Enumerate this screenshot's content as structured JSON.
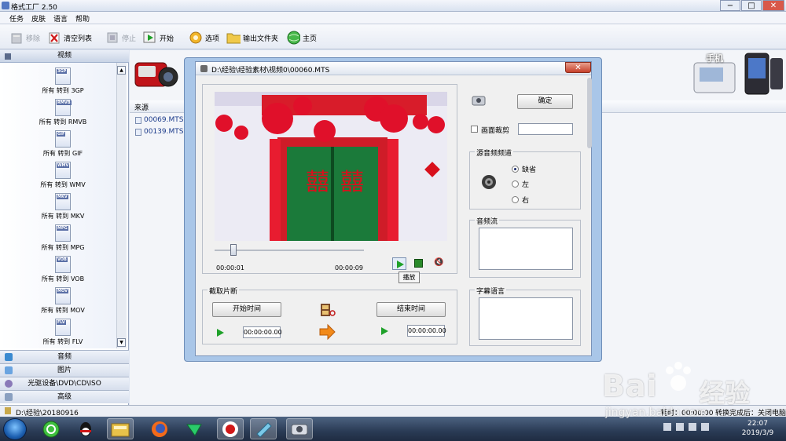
{
  "window": {
    "title": "格式工厂 2.50"
  },
  "menu": [
    "任务",
    "皮肤",
    "语言",
    "帮助"
  ],
  "toolbar": {
    "remove": "移除",
    "clear": "清空列表",
    "stop": "停止",
    "start": "开始",
    "options": "选项",
    "output": "输出文件夹",
    "home": "主页"
  },
  "left": {
    "video_header": "视频",
    "formats": [
      {
        "badge": "3GP",
        "label": "所有 转到 3GP"
      },
      {
        "badge": "RMVB",
        "label": "所有 转到 RMVB"
      },
      {
        "badge": "GIF",
        "label": "所有 转到 GIF"
      },
      {
        "badge": "WMV",
        "label": "所有 转到 WMV"
      },
      {
        "badge": "MKV",
        "label": "所有 转到 MKV"
      },
      {
        "badge": "MPG",
        "label": "所有 转到 MPG"
      },
      {
        "badge": "VOB",
        "label": "所有 转到 VOB"
      },
      {
        "badge": "MOV",
        "label": "所有 转到 MOV"
      },
      {
        "badge": "FLV",
        "label": "所有 转到 FLV"
      }
    ],
    "categories": [
      "音频",
      "图片",
      "光驱设备\\DVD\\CD\\ISO",
      "高级"
    ]
  },
  "main": {
    "source_header": "来源",
    "files": [
      "00069.MTS",
      "00139.MTS"
    ],
    "phone_label": "手机"
  },
  "status": {
    "path": "D:\\经验\\20180916",
    "elapsed": "耗时：00:00:00",
    "after": "转换完成后：关闭电脑"
  },
  "dialog": {
    "title": "D:\\经验\\经验素材\\视频0\\00060.MTS",
    "time_start": "00:00:01",
    "time_end": "00:00:09",
    "tooltip": "播放",
    "ok": "确定",
    "crop_label": "画面裁剪",
    "audio_channel": {
      "title": "源音频频道",
      "options": [
        "缺省",
        "左",
        "右"
      ],
      "selected": "缺省"
    },
    "audio_stream": "音频流",
    "subtitle_lang": "字幕语言",
    "clip": {
      "title": "截取片断",
      "start_btn": "开始时间",
      "end_btn": "结束时间",
      "start_val": "00:00:00.00",
      "end_val": "00:00:00.00"
    }
  },
  "taskbar": {
    "time": "22:07",
    "date": "2019/3/9"
  },
  "watermark": {
    "text1": "Bai",
    "text2": "经验",
    "url": "jingyan.baidu.com"
  }
}
